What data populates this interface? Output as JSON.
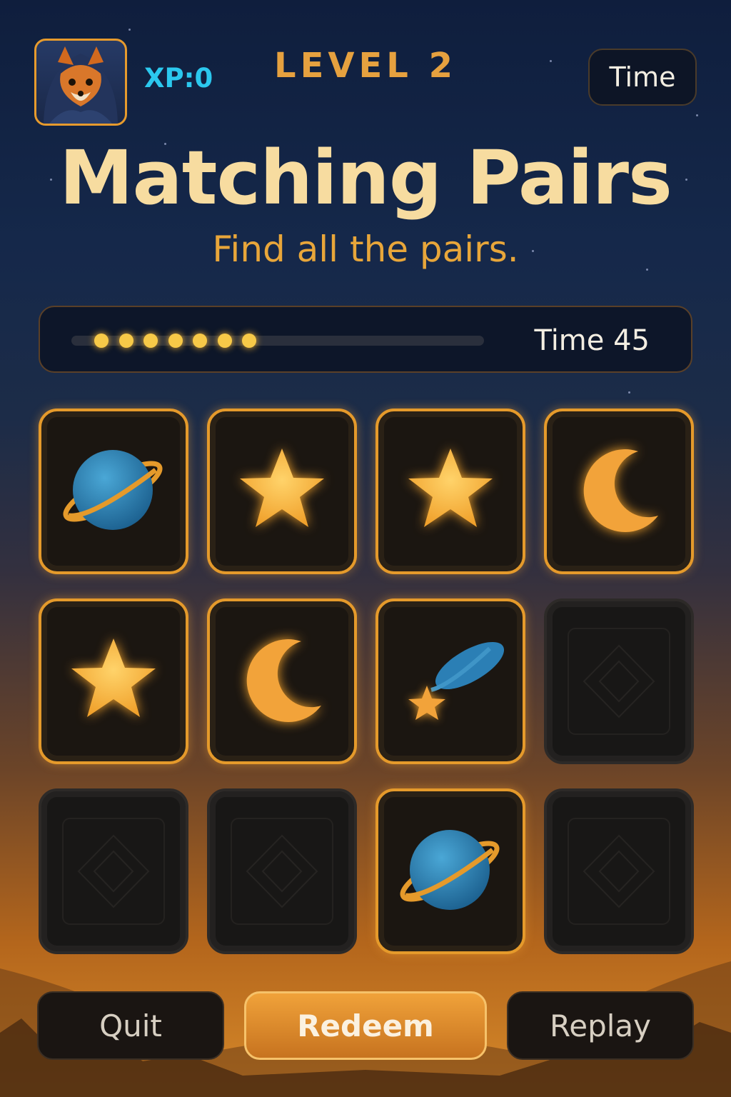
{
  "header": {
    "xp_label": "XP:0",
    "level_label": "LEVEL 2",
    "time_button_label": "Time",
    "avatar_icon": "fox-avatar-icon"
  },
  "title": "Matching Pairs",
  "subtitle": "Find all the pairs.",
  "progress": {
    "filled_dots": 7,
    "timer_label": "Time",
    "timer_value": "45"
  },
  "board": {
    "rows": 3,
    "cols": 4,
    "cards": [
      {
        "state": "revealed",
        "icon": "planet"
      },
      {
        "state": "revealed",
        "icon": "star"
      },
      {
        "state": "revealed",
        "icon": "star"
      },
      {
        "state": "revealed",
        "icon": "moon"
      },
      {
        "state": "revealed",
        "icon": "star"
      },
      {
        "state": "revealed",
        "icon": "moon"
      },
      {
        "state": "revealed",
        "icon": "comet"
      },
      {
        "state": "hidden",
        "icon": "card-back"
      },
      {
        "state": "hidden",
        "icon": "card-back"
      },
      {
        "state": "hidden",
        "icon": "card-back"
      },
      {
        "state": "revealed",
        "icon": "planet"
      },
      {
        "state": "hidden",
        "icon": "card-back"
      }
    ]
  },
  "buttons": {
    "quit": "Quit",
    "redeem": "Redeem",
    "replay": "Replay"
  },
  "colors": {
    "accent_gold": "#e59a2b",
    "xp_cyan": "#2bc8ee",
    "icon_blue": "#2b7fb5"
  }
}
